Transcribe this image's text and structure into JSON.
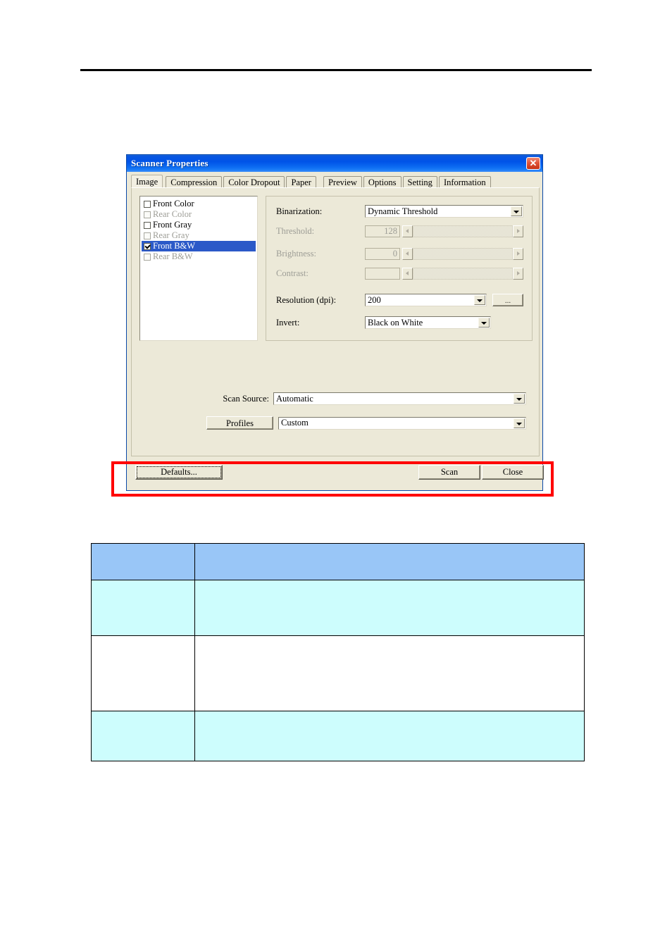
{
  "page": {
    "rule": "horizontal-rule"
  },
  "dialog": {
    "title": "Scanner Properties",
    "close_label": "✕",
    "tabs": [
      {
        "label": "Image",
        "active": true
      },
      {
        "label": "Compression",
        "active": false
      },
      {
        "label": "Color Dropout",
        "active": false
      },
      {
        "label": "Paper",
        "active": false
      },
      {
        "label": "Preview",
        "active": false
      },
      {
        "label": "Options",
        "active": false
      },
      {
        "label": "Setting",
        "active": false
      },
      {
        "label": "Information",
        "active": false
      }
    ],
    "image_types": [
      {
        "label": "Front Color",
        "checked": false,
        "enabled": true,
        "selected": false
      },
      {
        "label": "Rear Color",
        "checked": false,
        "enabled": false,
        "selected": false
      },
      {
        "label": "Front Gray",
        "checked": false,
        "enabled": true,
        "selected": false
      },
      {
        "label": "Rear Gray",
        "checked": false,
        "enabled": false,
        "selected": false
      },
      {
        "label": "Front B&W",
        "checked": true,
        "enabled": true,
        "selected": true
      },
      {
        "label": "Rear B&W",
        "checked": false,
        "enabled": false,
        "selected": false
      }
    ],
    "settings": {
      "binarization_label": "Binarization:",
      "binarization_value": "Dynamic Threshold",
      "threshold_label": "Threshold:",
      "threshold_value": "128",
      "brightness_label": "Brightness:",
      "brightness_value": "0",
      "contrast_label": "Contrast:",
      "contrast_value": "",
      "resolution_label": "Resolution (dpi):",
      "resolution_value": "200",
      "resolution_more_label": "...",
      "invert_label": "Invert:",
      "invert_value": "Black on White"
    },
    "scan_source_label": "Scan Source:",
    "scan_source_value": "Automatic",
    "profiles_label": "Profiles",
    "profiles_value": "Custom",
    "buttons": {
      "defaults": "Defaults...",
      "scan": "Scan",
      "close": "Close"
    }
  },
  "annotation": {
    "highlight": "red-rectangle-around-button-bar",
    "color": "#ff0000"
  },
  "table": {
    "header_accent": "#99c6f7",
    "row_accent": "#cdfdfd",
    "rows": [
      {
        "style": "head",
        "cells": [
          "",
          ""
        ]
      },
      {
        "style": "cyan",
        "cells": [
          "",
          ""
        ]
      },
      {
        "style": "white",
        "cells": [
          "",
          ""
        ]
      },
      {
        "style": "cyan",
        "cells": [
          "",
          ""
        ]
      }
    ]
  }
}
